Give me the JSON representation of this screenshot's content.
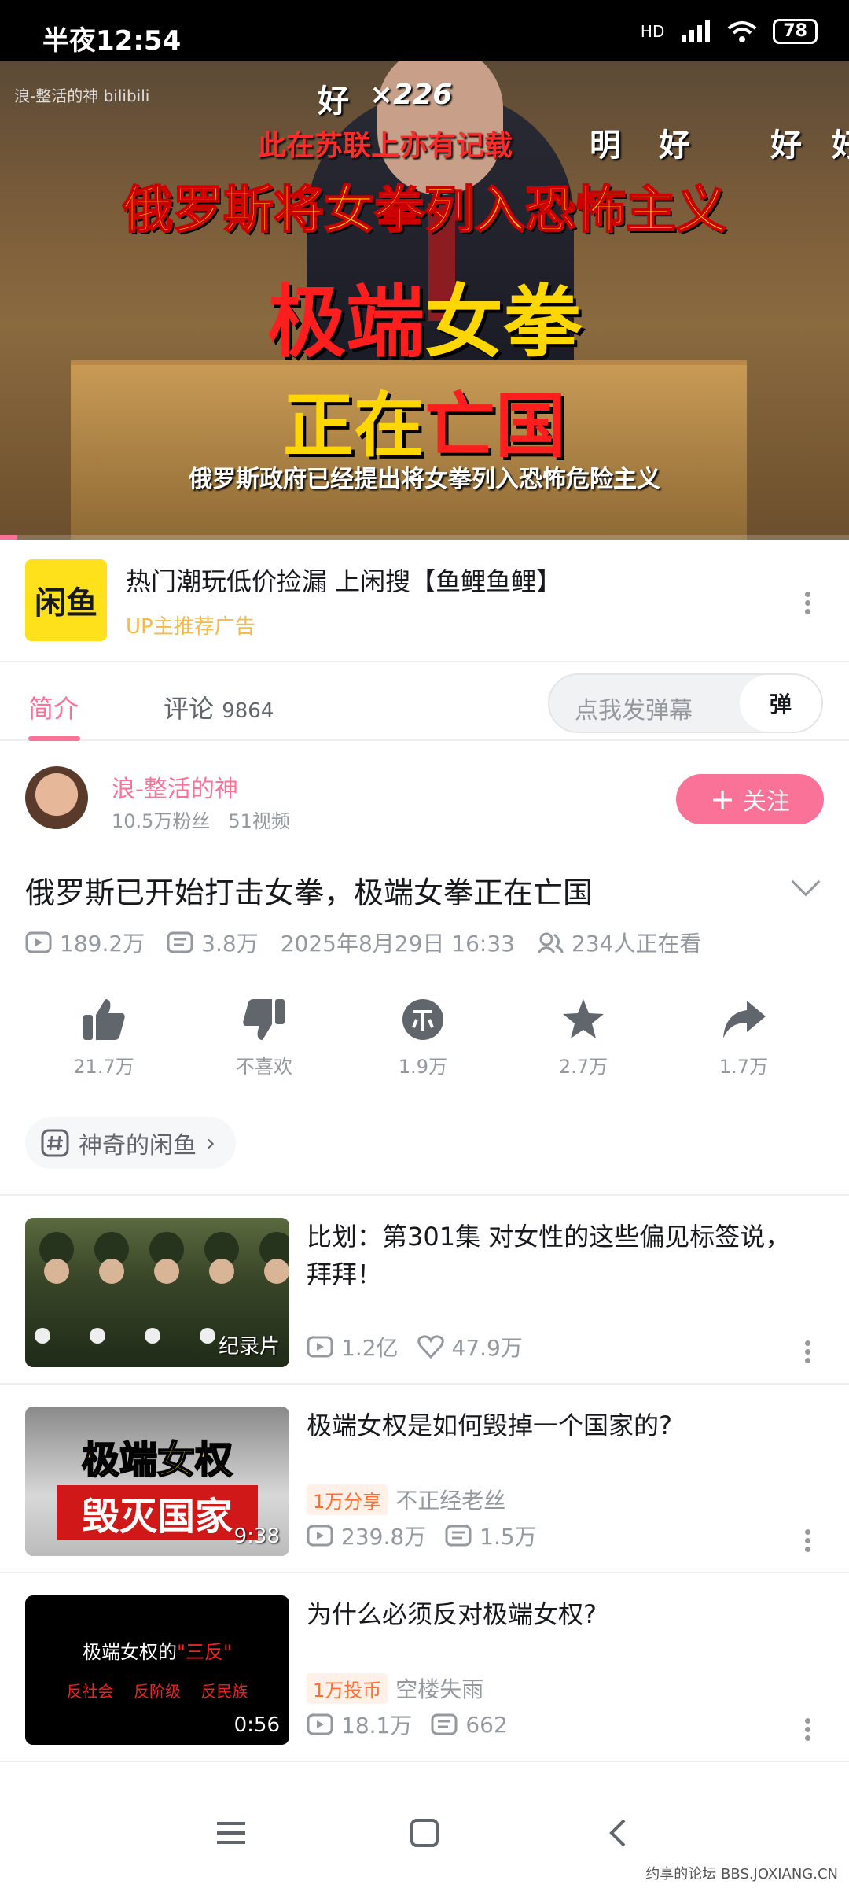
{
  "status_bar": {
    "time": "半夜12:54",
    "network": "HD",
    "battery": "78"
  },
  "video": {
    "watermark": "浪-整活的神 bilibili",
    "danmaku": [
      "好",
      "×226",
      "此在苏联上亦有记载",
      "明",
      "好",
      "好",
      "好"
    ],
    "headline_1": "俄罗斯将女拳列入恐怖主义",
    "headline_2a": "极端",
    "headline_2b": "女拳",
    "headline_3a": "正在",
    "headline_3b": "亡国",
    "subtitle": "俄罗斯政府已经提出将女拳列入恐怖危险主义",
    "progress": 0.02
  },
  "ad": {
    "logo": "闲鱼",
    "title": "热门潮玩低价捡漏 上闲搜【鱼鲤鱼鲤】",
    "sub": "UP主推荐广告"
  },
  "tabs": {
    "intro": "简介",
    "comments": "评论",
    "comments_count": "9864",
    "danmaku_placeholder": "点我发弹幕",
    "danmaku_button": "弹"
  },
  "author": {
    "name": "浪-整活的神",
    "fans": "10.5万粉丝",
    "videos": "51视频",
    "follow_label": "关注"
  },
  "video_info": {
    "title": "俄罗斯已开始打击女拳，极端女拳正在亡国",
    "views": "189.2万",
    "danmaku_count": "3.8万",
    "date": "2025年8月29日 16:33",
    "watching": "234人正在看"
  },
  "actions": [
    {
      "icon": "thumbs-up-icon",
      "label": "21.7万"
    },
    {
      "icon": "thumbs-down-icon",
      "label": "不喜欢"
    },
    {
      "icon": "coin-icon",
      "label": "1.9万"
    },
    {
      "icon": "star-icon",
      "label": "2.7万"
    },
    {
      "icon": "share-icon",
      "label": "1.7万"
    }
  ],
  "tag": {
    "label": "神奇的闲鱼"
  },
  "recommendations": [
    {
      "title": "比划：第301集 对女性的这些偏见标签说，拜拜！",
      "badge": "纪录片",
      "views": "1.2亿",
      "likes": "47.9万"
    },
    {
      "title": "极端女权是如何毁掉一个国家的?",
      "thumb_text_1": "极端女权",
      "thumb_text_2": "毁灭国家",
      "badge": "9:38",
      "pill": "1万分享",
      "uploader": "不正经老丝",
      "views": "239.8万",
      "danmaku": "1.5万"
    },
    {
      "title": "为什么必须反对极端女权?",
      "thumb_text_1": "极端女权的",
      "thumb_text_1b": "\"三反\"",
      "thumb_text_2": "反社会    反阶级    反民族",
      "badge": "0:56",
      "pill": "1万投币",
      "uploader": "空楼失雨",
      "views": "18.1万",
      "danmaku": "662"
    }
  ],
  "forum_watermark": "约享的论坛 BBS.JOXIANG.CN",
  "colors": {
    "accent": "#fb7299",
    "ad_yellow": "#ffe11b",
    "status_bg": "#000000"
  }
}
